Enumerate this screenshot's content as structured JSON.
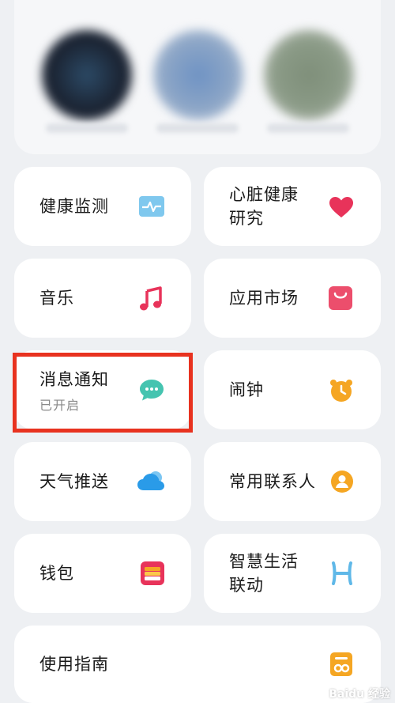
{
  "cards": {
    "health_monitor": {
      "title": "健康监测",
      "icon": "heart-rate-icon",
      "color": "#5fb8e8"
    },
    "heart_research": {
      "title_line1": "心脏健康",
      "title_line2": "研究",
      "icon": "heart-icon",
      "color": "#e8335a"
    },
    "music": {
      "title": "音乐",
      "icon": "music-note-icon",
      "color": "#e8335a"
    },
    "app_market": {
      "title": "应用市场",
      "icon": "shopping-bag-icon",
      "color": "#e8335a"
    },
    "notifications": {
      "title": "消息通知",
      "status": "已开启",
      "icon": "chat-bubble-icon",
      "color": "#45c4b0"
    },
    "alarm": {
      "title": "闹钟",
      "icon": "alarm-clock-icon",
      "color": "#f5a623"
    },
    "weather": {
      "title": "天气推送",
      "icon": "cloud-icon",
      "color": "#2a9be8"
    },
    "contacts": {
      "title": "常用联系人",
      "icon": "contact-icon",
      "color": "#f5a623"
    },
    "wallet": {
      "title": "钱包",
      "icon": "wallet-icon",
      "color": "#e8335a"
    },
    "smart_life": {
      "title_line1": "智慧生活",
      "title_line2": "联动",
      "icon": "smart-link-icon",
      "color": "#5fb8e8"
    },
    "guide": {
      "title": "使用指南",
      "icon": "guide-book-icon",
      "color": "#f5a623"
    }
  },
  "watermark": "Baidu 经验"
}
